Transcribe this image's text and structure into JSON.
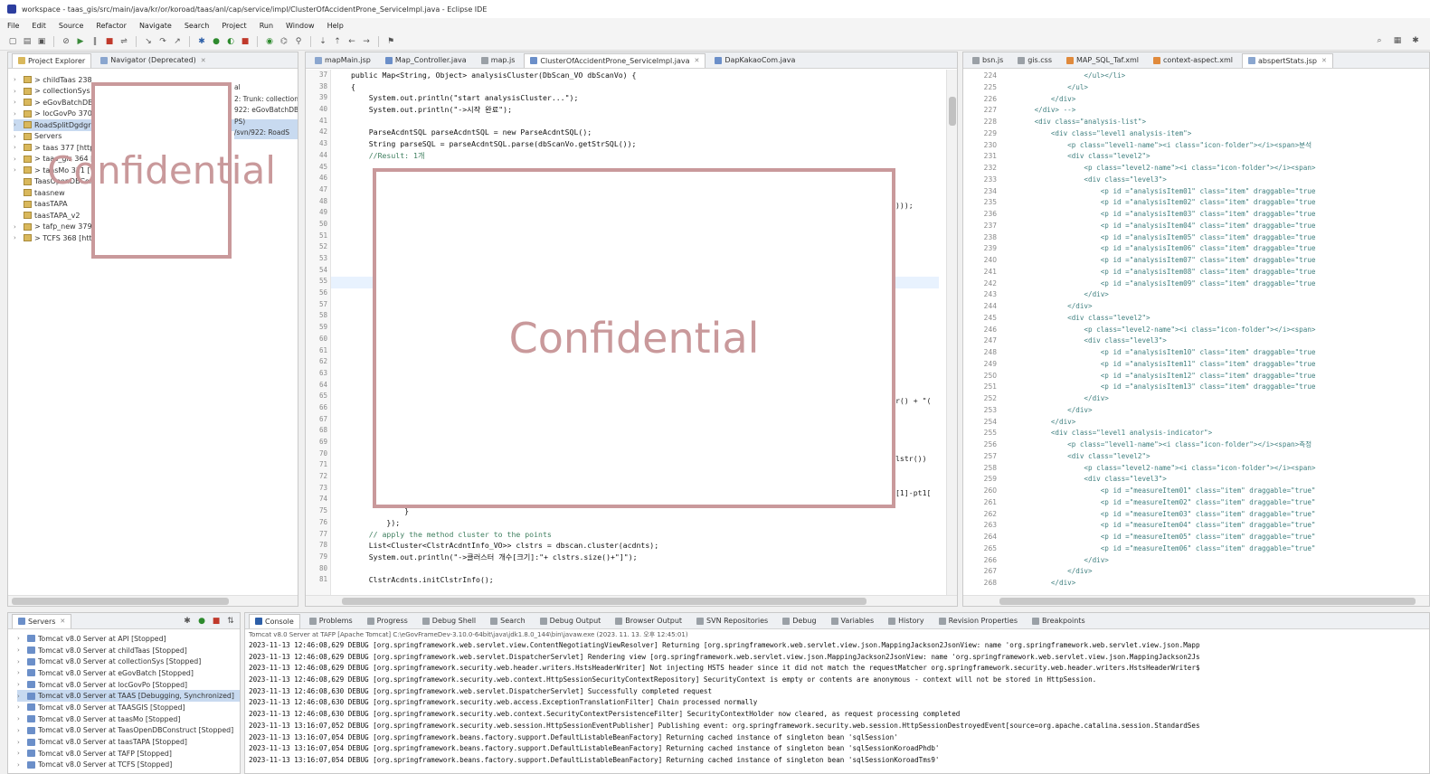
{
  "window": {
    "title": "workspace - taas_gis/src/main/java/kr/or/koroad/taas/anl/cap/service/impl/ClusterOfAccidentProne_ServiceImpl.java - Eclipse IDE"
  },
  "menu": [
    "File",
    "Edit",
    "Source",
    "Refactor",
    "Navigate",
    "Search",
    "Project",
    "Run",
    "Window",
    "Help"
  ],
  "explorer": {
    "tabs": [
      "Project Explorer",
      "Navigator (Deprecated)"
    ],
    "items": [
      {
        "label": "> childTaas 238",
        "selected": false
      },
      {
        "label": "> collectionSys",
        "selected": false
      },
      {
        "label": "> eGovBatchDB",
        "selected": false
      },
      {
        "label": "> locGovPo 370",
        "selected": false
      },
      {
        "label": "RoadSplitDgdgr",
        "selected": true
      },
      {
        "label": "Servers",
        "selected": false
      },
      {
        "label": "> taas 377 [http",
        "selected": false
      },
      {
        "label": "> taas_gis 364 [",
        "selected": false
      },
      {
        "label": "> taasMo 311 [",
        "selected": false
      },
      {
        "label": "TaasOpenDBCon",
        "selected": false
      },
      {
        "label": "taasnew",
        "selected": false
      },
      {
        "label": "taasTAPA",
        "selected": false
      },
      {
        "label": "taasTAPA_v2",
        "selected": false
      },
      {
        "label": "> tafp_new 379",
        "selected": false
      },
      {
        "label": "> TCFS 368 [htt",
        "selected": false
      }
    ],
    "side_fragments": [
      "al",
      "2: Trunk: collection",
      "922: eGovBatchDB",
      "PS)",
      "/svn/922: RoadS"
    ],
    "redaction_text": "Confidential"
  },
  "editor": {
    "tabs": [
      {
        "label": "mapMain.jsp",
        "active": false
      },
      {
        "label": "Map_Controller.java",
        "active": false
      },
      {
        "label": "map.js",
        "active": false
      },
      {
        "label": "ClusterOfAccidentProne_ServiceImpl.java",
        "active": true
      },
      {
        "label": "DapKakaoCom.java",
        "active": false
      }
    ],
    "line_numbers": [
      "37",
      "38",
      "39",
      "40",
      "41",
      "42",
      "43",
      "44",
      "45",
      "46",
      "47",
      "48",
      "49",
      "50",
      "51",
      "52",
      "53",
      "54",
      "55",
      "56",
      "57",
      "58",
      "59",
      "60",
      "61",
      "62",
      "63",
      "64",
      "65",
      "66",
      "67",
      "68",
      "69",
      "70",
      "71",
      "72",
      "73",
      "74",
      "75",
      "76",
      "77",
      "78",
      "79",
      "80",
      "81"
    ],
    "lines": [
      "public Map<String, Object> analysisCluster(DbScan_VO dbScanVo) {",
      "{",
      "    System.out.println(\"start analysisCluster...\");",
      "    System.out.println(\"->시작 완료\");",
      "",
      "    ParseAcdntSQL parseAcdntSQL = new ParseAcdntSQL();",
      "    String parseSQL = parseAcdntSQL.parse(dbScanVo.getStrSQL());",
      "    //Result: 1개",
      "",
      "",
      "",
      "",
      "",
      "",
      "",
      "",
      "",
      "",
      "",
      "",
      "",
      "",
      "",
      "",
      "",
      "",
      "",
      "",
      "",
      "",
      "",
      "",
      "",
      "",
      "",
      "",
      "",
      "",
      "            }",
      "        });",
      "    // apply the method cluster to the points",
      "    List<Cluster<ClstrAcdntInfo_VO>> clstrs = dbscan.cluster(acdnts);",
      "    System.out.println(\"->클러스터 개수[크기]:\"+ clstrs.size()+\"]\");",
      "",
      "    ClstrAcdnts.initClstrInfo();"
    ],
    "fragments": [
      ")));",
      "r() + \"(",
      "lstr())",
      "[1]-pt1["
    ],
    "redaction_text": "Confidential"
  },
  "xml_editor": {
    "tabs": [
      "bsn.js",
      "gis.css",
      "MAP_SQL_Taf.xml",
      "context-aspect.xml",
      "abspertStats.jsp"
    ],
    "line_numbers": [
      "224",
      "225",
      "226",
      "227",
      "228",
      "229",
      "230",
      "231",
      "232",
      "233",
      "234",
      "235",
      "236",
      "237",
      "238",
      "239",
      "240",
      "241",
      "242",
      "243",
      "244",
      "245",
      "246",
      "247",
      "248",
      "249",
      "250",
      "251",
      "252",
      "253",
      "254",
      "255",
      "256",
      "257",
      "258",
      "259",
      "260",
      "261",
      "262",
      "263",
      "264",
      "265",
      "266",
      "267",
      "268"
    ],
    "lines": [
      "                    </ul></li>",
      "                </ul>",
      "            </div>",
      "        </div> -->",
      "        <div class=\"analysis-list\">",
      "            <div class=\"level1 analysis-item\">",
      "                <p class=\"level1-name\"><i class=\"icon-folder\"></i><span>분석",
      "                <div class=\"level2\">",
      "                    <p class=\"level2-name\"><i class=\"icon-folder\"></i><span>",
      "                    <div class=\"level3\">",
      "                        <p id =\"analysisItem01\" class=\"item\" draggable=\"true",
      "                        <p id =\"analysisItem02\" class=\"item\" draggable=\"true",
      "                        <p id =\"analysisItem03\" class=\"item\" draggable=\"true",
      "                        <p id =\"analysisItem04\" class=\"item\" draggable=\"true",
      "                        <p id =\"analysisItem05\" class=\"item\" draggable=\"true",
      "                        <p id =\"analysisItem06\" class=\"item\" draggable=\"true",
      "                        <p id =\"analysisItem07\" class=\"item\" draggable=\"true",
      "                        <p id =\"analysisItem08\" class=\"item\" draggable=\"true",
      "                        <p id =\"analysisItem09\" class=\"item\" draggable=\"true",
      "                    </div>",
      "                </div>",
      "                <div class=\"level2\">",
      "                    <p class=\"level2-name\"><i class=\"icon-folder\"></i><span>",
      "                    <div class=\"level3\">",
      "                        <p id =\"analysisItem10\" class=\"item\" draggable=\"true",
      "                        <p id =\"analysisItem11\" class=\"item\" draggable=\"true",
      "                        <p id =\"analysisItem12\" class=\"item\" draggable=\"true",
      "                        <p id =\"analysisItem13\" class=\"item\" draggable=\"true",
      "                    </div>",
      "                </div>",
      "            </div>",
      "            <div class=\"level1 analysis-indicator\">",
      "                <p class=\"level1-name\"><i class=\"icon-folder\"></i><span>측정",
      "                <div class=\"level2\">",
      "                    <p class=\"level2-name\"><i class=\"icon-folder\"></i><span>",
      "                    <div class=\"level3\">",
      "                        <p id =\"measureItem01\" class=\"item\" draggable=\"true\"",
      "                        <p id =\"measureItem02\" class=\"item\" draggable=\"true\"",
      "                        <p id =\"measureItem03\" class=\"item\" draggable=\"true\"",
      "                        <p id =\"measureItem04\" class=\"item\" draggable=\"true\"",
      "                        <p id =\"measureItem05\" class=\"item\" draggable=\"true\"",
      "                        <p id =\"measureItem06\" class=\"item\" draggable=\"true\"",
      "                    </div>",
      "                </div>",
      "            </div>"
    ]
  },
  "servers_panel": {
    "tab": "Servers",
    "items": [
      {
        "label": "Tomcat v8.0 Server at API  [Stopped]",
        "selected": false
      },
      {
        "label": "Tomcat v8.0 Server at childTaas  [Stopped]",
        "selected": false
      },
      {
        "label": "Tomcat v8.0 Server at collectionSys  [Stopped]",
        "selected": false
      },
      {
        "label": "Tomcat v8.0 Server at eGovBatch  [Stopped]",
        "selected": false
      },
      {
        "label": "Tomcat v8.0 Server at locGovPo  [Stopped]",
        "selected": false
      },
      {
        "label": "Tomcat v8.0 Server at TAAS  [Debugging, Synchronized]",
        "selected": true
      },
      {
        "label": "Tomcat v8.0 Server at TAASGIS  [Stopped]",
        "selected": false
      },
      {
        "label": "Tomcat v8.0 Server at taasMo  [Stopped]",
        "selected": false
      },
      {
        "label": "Tomcat v8.0 Server at TaasOpenDBConstruct  [Stopped]",
        "selected": false
      },
      {
        "label": "Tomcat v8.0 Server at taasTAPA  [Stopped]",
        "selected": false
      },
      {
        "label": "Tomcat v8.0 Server at TAFP  [Stopped]",
        "selected": false
      },
      {
        "label": "Tomcat v8.0 Server at TCFS  [Stopped]",
        "selected": false
      }
    ]
  },
  "console": {
    "tabs": [
      "Console",
      "Problems",
      "Progress",
      "Debug Shell",
      "Search",
      "Debug Output",
      "Browser Output",
      "SVN Repositories",
      "Debug",
      "Variables",
      "History",
      "Revision Properties",
      "Breakpoints"
    ],
    "header": "Tomcat v8.0 Server at TAFP [Apache Tomcat] C:\\eGovFrameDev-3.10.0-64bit\\java\\jdk1.8.0_144\\bin\\javaw.exe (2023. 11. 13. 오후 12:45:01)",
    "lines": [
      "2023-11-13 12:46:08,629 DEBUG [org.springframework.web.servlet.view.ContentNegotiatingViewResolver] Returning [org.springframework.web.servlet.view.json.MappingJackson2JsonView: name 'org.springframework.web.servlet.view.json.Mapp",
      "2023-11-13 12:46:08,629 DEBUG [org.springframework.web.servlet.DispatcherServlet] Rendering view [org.springframework.web.servlet.view.json.MappingJackson2JsonView: name 'org.springframework.web.servlet.view.json.MappingJackson2Js",
      "2023-11-13 12:46:08,629 DEBUG [org.springframework.security.web.header.writers.HstsHeaderWriter] Not injecting HSTS header since it did not match the requestMatcher org.springframework.security.web.header.writers.HstsHeaderWriter$",
      "2023-11-13 12:46:08,629 DEBUG [org.springframework.security.web.context.HttpSessionSecurityContextRepository] SecurityContext is empty or contents are anonymous - context will not be stored in HttpSession.",
      "2023-11-13 12:46:08,630 DEBUG [org.springframework.web.servlet.DispatcherServlet] Successfully completed request",
      "2023-11-13 12:46:08,630 DEBUG [org.springframework.security.web.access.ExceptionTranslationFilter] Chain processed normally",
      "2023-11-13 12:46:08,630 DEBUG [org.springframework.security.web.context.SecurityContextPersistenceFilter] SecurityContextHolder now cleared, as request processing completed",
      "2023-11-13 13:16:07,052 DEBUG [org.springframework.security.web.session.HttpSessionEventPublisher] Publishing event: org.springframework.security.web.session.HttpSessionDestroyedEvent[source=org.apache.catalina.session.StandardSes",
      "2023-11-13 13:16:07,054 DEBUG [org.springframework.beans.factory.support.DefaultListableBeanFactory] Returning cached instance of singleton bean 'sqlSession'",
      "2023-11-13 13:16:07,054 DEBUG [org.springframework.beans.factory.support.DefaultListableBeanFactory] Returning cached instance of singleton bean 'sqlSessionKoroadPhdb'",
      "2023-11-13 13:16:07,054 DEBUG [org.springframework.beans.factory.support.DefaultListableBeanFactory] Returning cached instance of singleton bean 'sqlSessionKoroadTms9'"
    ]
  }
}
